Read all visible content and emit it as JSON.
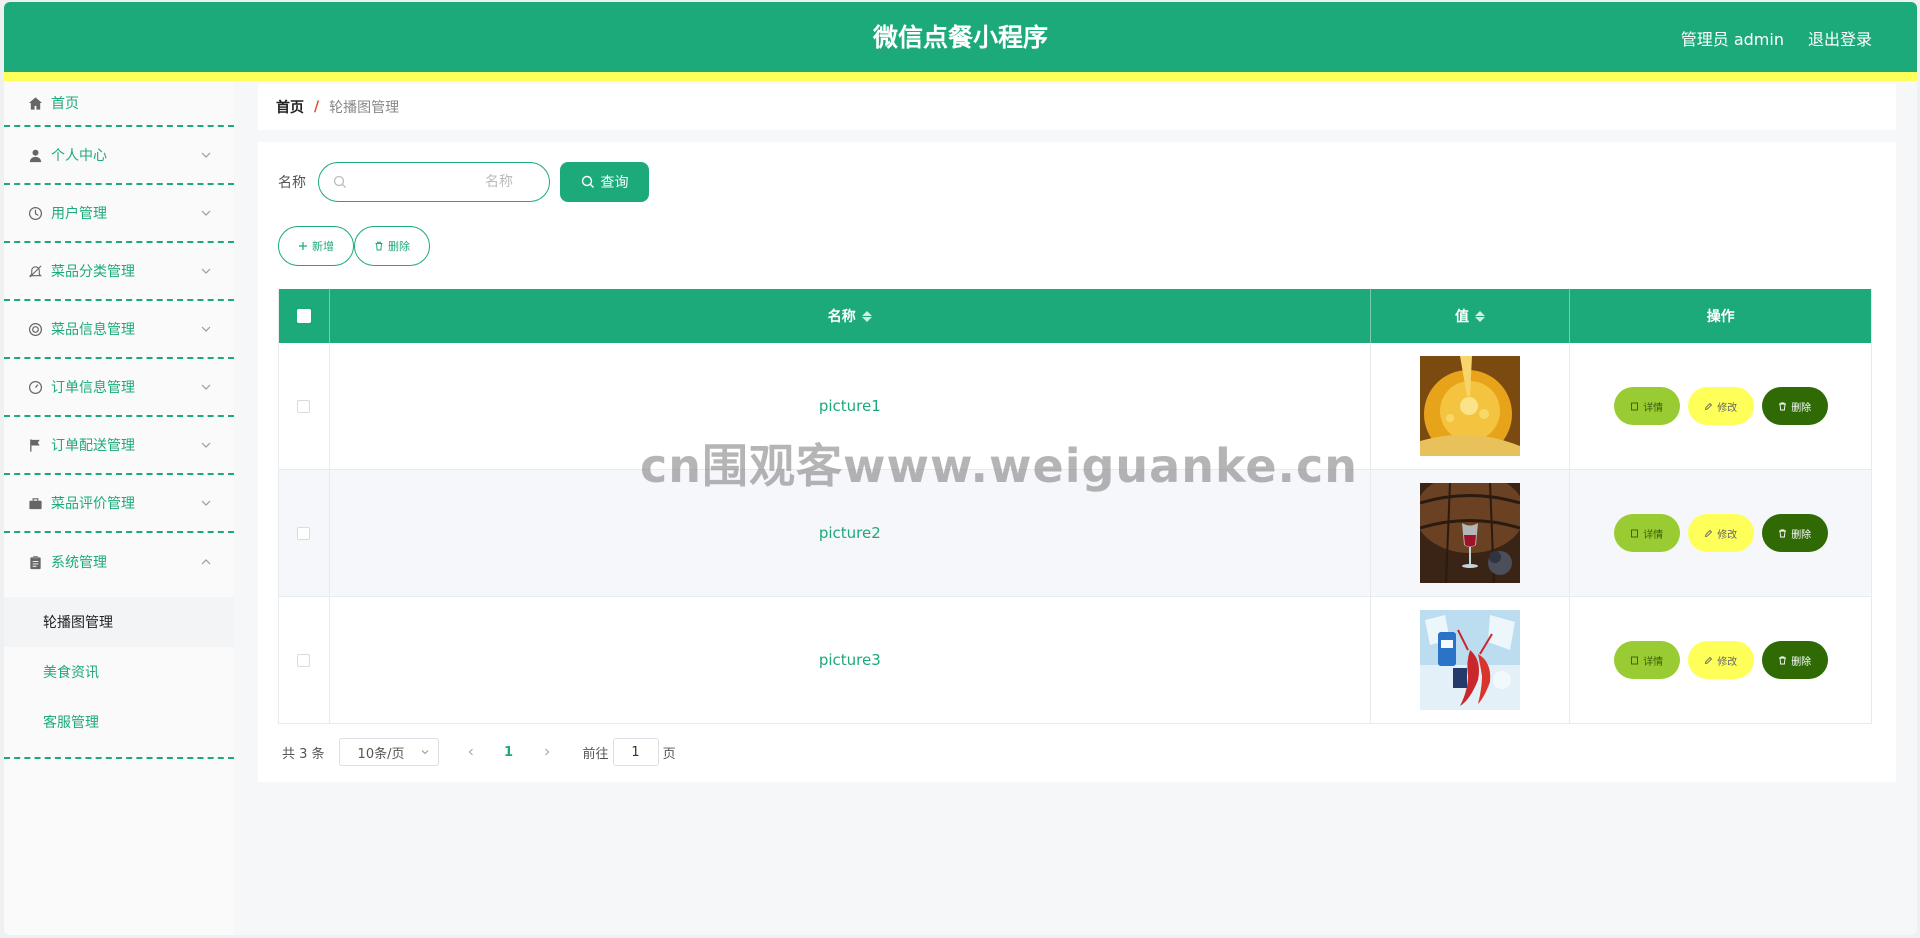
{
  "header": {
    "title": "微信点餐小程序",
    "user_label": "管理员 admin",
    "logout_label": "退出登录"
  },
  "sidebar": {
    "items": [
      {
        "label": "首页",
        "icon": "home-icon"
      },
      {
        "label": "个人中心",
        "icon": "user-icon"
      },
      {
        "label": "用户管理",
        "icon": "clock-icon"
      },
      {
        "label": "菜品分类管理",
        "icon": "bell-off-icon"
      },
      {
        "label": "菜品信息管理",
        "icon": "lifebuoy-icon"
      },
      {
        "label": "订单信息管理",
        "icon": "gauge-icon"
      },
      {
        "label": "订单配送管理",
        "icon": "flag-icon"
      },
      {
        "label": "菜品评价管理",
        "icon": "briefcase-icon"
      },
      {
        "label": "系统管理",
        "icon": "clipboard-icon"
      }
    ],
    "sub_items": [
      {
        "label": "轮播图管理",
        "active": true
      },
      {
        "label": "美食资讯",
        "active": false
      },
      {
        "label": "客服管理",
        "active": false
      }
    ]
  },
  "breadcrumb": {
    "home": "首页",
    "separator": "/",
    "current": "轮播图管理"
  },
  "search": {
    "label": "名称",
    "placeholder": "名称",
    "value": "",
    "button_label": "查询"
  },
  "actions": {
    "add_label": "新增",
    "delete_label": "删除"
  },
  "table": {
    "columns": {
      "name": "名称",
      "value": "值",
      "ops": "操作"
    },
    "rows": [
      {
        "name": "picture1",
        "image": "honey-drizzle"
      },
      {
        "name": "picture2",
        "image": "wine-barrel"
      },
      {
        "name": "picture3",
        "image": "crayfish-ice"
      }
    ],
    "op_labels": {
      "detail": "详情",
      "edit": "修改",
      "delete": "删除"
    }
  },
  "pagination": {
    "total_text": "共 3 条",
    "page_size": "10条/页",
    "current_page": "1",
    "goto_prefix": "前往",
    "goto_value": "1",
    "goto_suffix": "页"
  },
  "watermark": "cn围观客www.weiguanke.cn",
  "colors": {
    "primary": "#1daa7b",
    "stripe": "#ffff5a",
    "detail": "#99cc33",
    "edit": "#ffff5a",
    "delete": "#2f6a05"
  }
}
